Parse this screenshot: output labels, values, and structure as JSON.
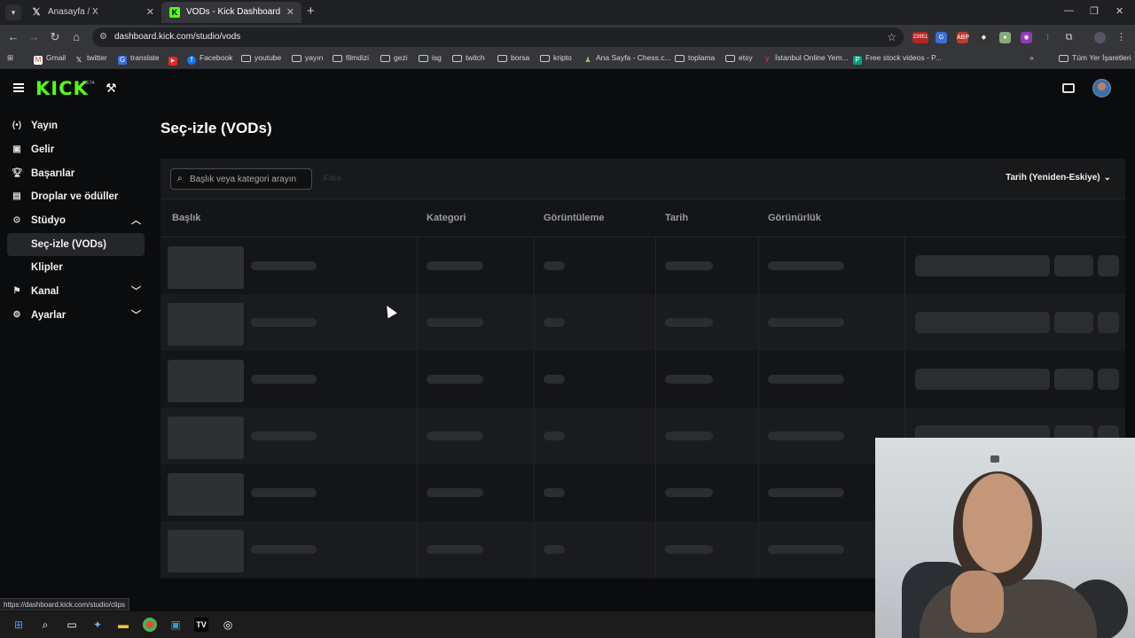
{
  "browser": {
    "tabs": [
      {
        "title": "Anasayfa / X",
        "icon": "x-logo-icon"
      },
      {
        "title": "VODs - Kick Dashboard",
        "icon": "kick-logo-icon"
      }
    ],
    "url": "dashboard.kick.com/studio/vods",
    "bookmarks": [
      "Gmail",
      "twitter",
      "translate",
      "Facebook",
      "youtube",
      "yayın",
      "filmdizi",
      "gezi",
      "isg",
      "twitch",
      "borsa",
      "kripto",
      "Ana Sayfa - Chess.c...",
      "toplama",
      "etsy",
      "İstanbul Online Yem...",
      "Free stock videos - P...",
      "Tüm Yer İşaretleri"
    ],
    "ext_badge": "23951",
    "status_url": "https://dashboard.kick.com/studio/clips"
  },
  "app": {
    "logo": "KICK",
    "logo_badge": "BETA",
    "accent": "#53fc18"
  },
  "sidebar": {
    "items": [
      {
        "label": "Yayın",
        "icon": "broadcast-icon"
      },
      {
        "label": "Gelir",
        "icon": "revenue-icon"
      },
      {
        "label": "Başarılar",
        "icon": "trophy-icon"
      },
      {
        "label": "Droplar ve ödüller",
        "icon": "gift-icon"
      },
      {
        "label": "Stüdyo",
        "icon": "studio-icon"
      },
      {
        "label": "Seç-izle (VODs)"
      },
      {
        "label": "Klipler"
      },
      {
        "label": "Kanal",
        "icon": "channel-icon"
      },
      {
        "label": "Ayarlar",
        "icon": "gear-icon"
      }
    ]
  },
  "main": {
    "title": "Seç-izle (VODs)",
    "search_placeholder": "Başlık veya kategori arayın",
    "filter_label": "Filtre",
    "sort_label": "Tarih (Yeniden-Eskiye)",
    "columns": [
      "Başlık",
      "Kategori",
      "Görüntüleme",
      "Tarih",
      "Görünürlük"
    ]
  }
}
